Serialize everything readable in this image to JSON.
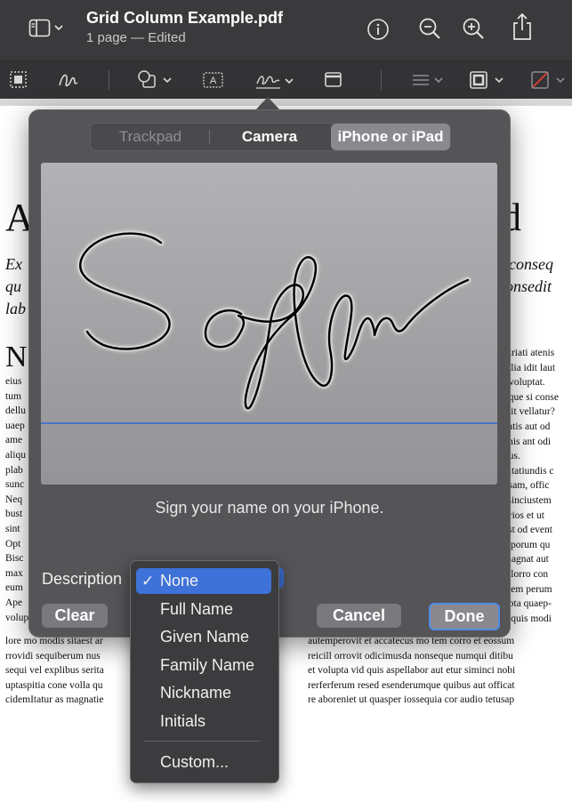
{
  "window": {
    "title": "Grid Column Example.pdf",
    "subtitle": "1 page — Edited"
  },
  "icons": {
    "sidebar": "sidebar-toggle-icon",
    "info": "info-icon",
    "zoom_out": "zoom-out-icon",
    "zoom_in": "zoom-in-icon",
    "share": "share-icon",
    "selection": "selection-icon",
    "sketch": "sketch-icon",
    "shapes": "shapes-icon",
    "textbox": "text-box-icon",
    "sign": "sign-icon",
    "note": "note-icon",
    "line_style": "line-style-icon",
    "border_color": "border-color-icon",
    "fill_color": "fill-color-icon"
  },
  "toolbar": {
    "textbox_glyph": "A"
  },
  "document": {
    "heading_left": "A",
    "heading_right": "d",
    "intro_left": [
      "Ex",
      "qu",
      "lab"
    ],
    "intro_right": [
      ", conseq",
      "onsedit"
    ],
    "section_initial": "N",
    "left_col": [
      "eius",
      "tum",
      "dellu",
      "uaep",
      "ame",
      "aliqu",
      "plab",
      "sunc",
      "Neq",
      "bust",
      "sint",
      "Opt",
      "Bisc",
      "max",
      "eum",
      "Ape",
      "volup"
    ],
    "right_col": [
      "turiati atenis",
      "cilia idit laut",
      "t voluptat.",
      "nque si conse",
      "elit vellatur?",
      "catis aut od",
      "enis ant odi",
      "bus.",
      "ditatiundis c",
      "osam, offic",
      "ssinciustem",
      "orios et ut",
      "est od event",
      "e porum qu",
      "magnat aut",
      "ellorro con",
      "atem perum",
      "upta quaep-",
      "taquis modi"
    ],
    "bottom_left": [
      "lore mo modis sitaest ar",
      "rrovidi sequiberum nus",
      "sequi vel explibus serita",
      "uptaspitia cone volla qu",
      "cidemItatur as magnatie"
    ],
    "bottom_right": [
      "autemperovit et accatecus mo tem corro et eossum",
      "reicill orrovit odicimusda nonseque numqui ditibu",
      "et volupta vid quis aspellabor aut etur siminci nobi",
      "rerferferum resed esenderumque quibus aut officat",
      "re aboreniet ut quasper iossequia cor audio tetusap"
    ]
  },
  "signature_panel": {
    "tabs": [
      "Trackpad",
      "Camera",
      "iPhone or iPad"
    ],
    "active_tab": "iPhone or iPad",
    "prompt": "Sign your name on your iPhone.",
    "description_label": "Description",
    "clear": "Clear",
    "cancel": "Cancel",
    "done": "Done",
    "baseline_color": "#4a73c9"
  },
  "description_menu": {
    "selected": "None",
    "check": "✓",
    "items": [
      "None",
      "Full Name",
      "Given Name",
      "Family Name",
      "Nickname",
      "Initials"
    ],
    "custom": "Custom...",
    "highlight_color": "#3e72d8"
  }
}
